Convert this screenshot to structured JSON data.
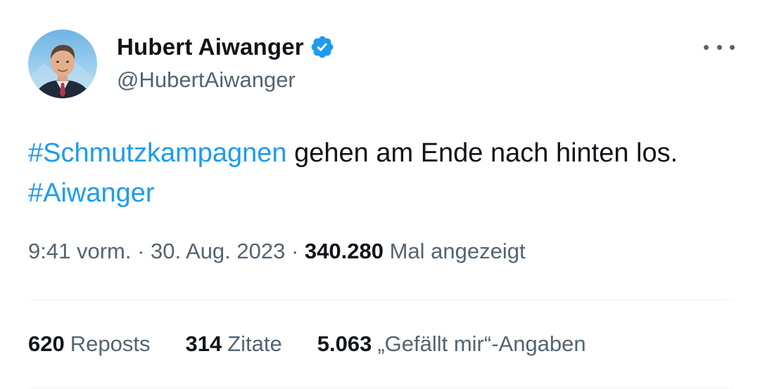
{
  "author": {
    "display_name": "Hubert Aiwanger",
    "handle": "@HubertAiwanger",
    "verified": true,
    "verified_icon": "verified-badge-icon",
    "avatar": "profile-photo"
  },
  "more_icon": "more-horizontal-icon",
  "tweet": {
    "hashtag1": "#Schmutzkampagnen",
    "text1": " gehen am Ende nach hinten los. ",
    "hashtag2": "#Aiwanger"
  },
  "meta": {
    "time": "9:41 vorm.",
    "sep1": " · ",
    "date": "30. Aug. 2023",
    "sep2": " · ",
    "views_count": "340.280",
    "views_label": " Mal angezeigt"
  },
  "stats": {
    "reposts_count": "620",
    "reposts_label": "Reposts",
    "quotes_count": "314",
    "quotes_label": "Zitate",
    "likes_count": "5.063",
    "likes_label": "„Gefällt mir“-Angaben"
  },
  "colors": {
    "text": "#0f1419",
    "secondary": "#536471",
    "accent": "#1d9bf0",
    "divider": "#eff3f4"
  }
}
